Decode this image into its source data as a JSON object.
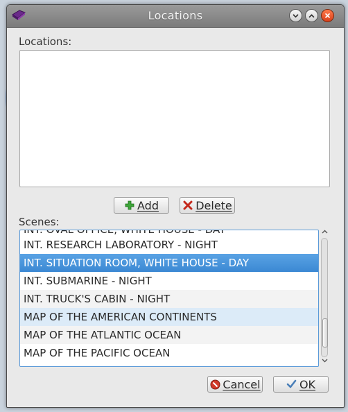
{
  "window": {
    "title": "Locations"
  },
  "locations": {
    "label": "Locations:",
    "items": []
  },
  "buttons": {
    "add": "Add",
    "delete": "Delete",
    "cancel": "Cancel",
    "ok": "OK"
  },
  "scenes": {
    "label": "Scenes:",
    "partial_top": "INT. OVAL OFFICE, WHITE HOUSE - DAY",
    "items": [
      "INT. RESEARCH LABORATORY - NIGHT",
      "INT. SITUATION ROOM, WHITE HOUSE - DAY",
      "INT. SUBMARINE - NIGHT",
      "INT. TRUCK'S CABIN - NIGHT",
      "MAP OF THE AMERICAN CONTINENTS",
      "MAP OF THE ATLANTIC OCEAN",
      "MAP OF THE PACIFIC OCEAN"
    ],
    "selected": "INT. SITUATION ROOM, WHITE HOUSE - DAY"
  },
  "colors": {
    "selection": "#3b88d3",
    "accent": "#5a9ad8",
    "close_button": "#d8401b"
  },
  "icons": {
    "app": "app-icon",
    "minimize": "minimize-icon",
    "maximize": "maximize-icon",
    "close": "close-icon",
    "add": "plus-icon",
    "delete": "x-icon",
    "cancel": "cancel-icon",
    "ok": "checkmark-icon"
  }
}
